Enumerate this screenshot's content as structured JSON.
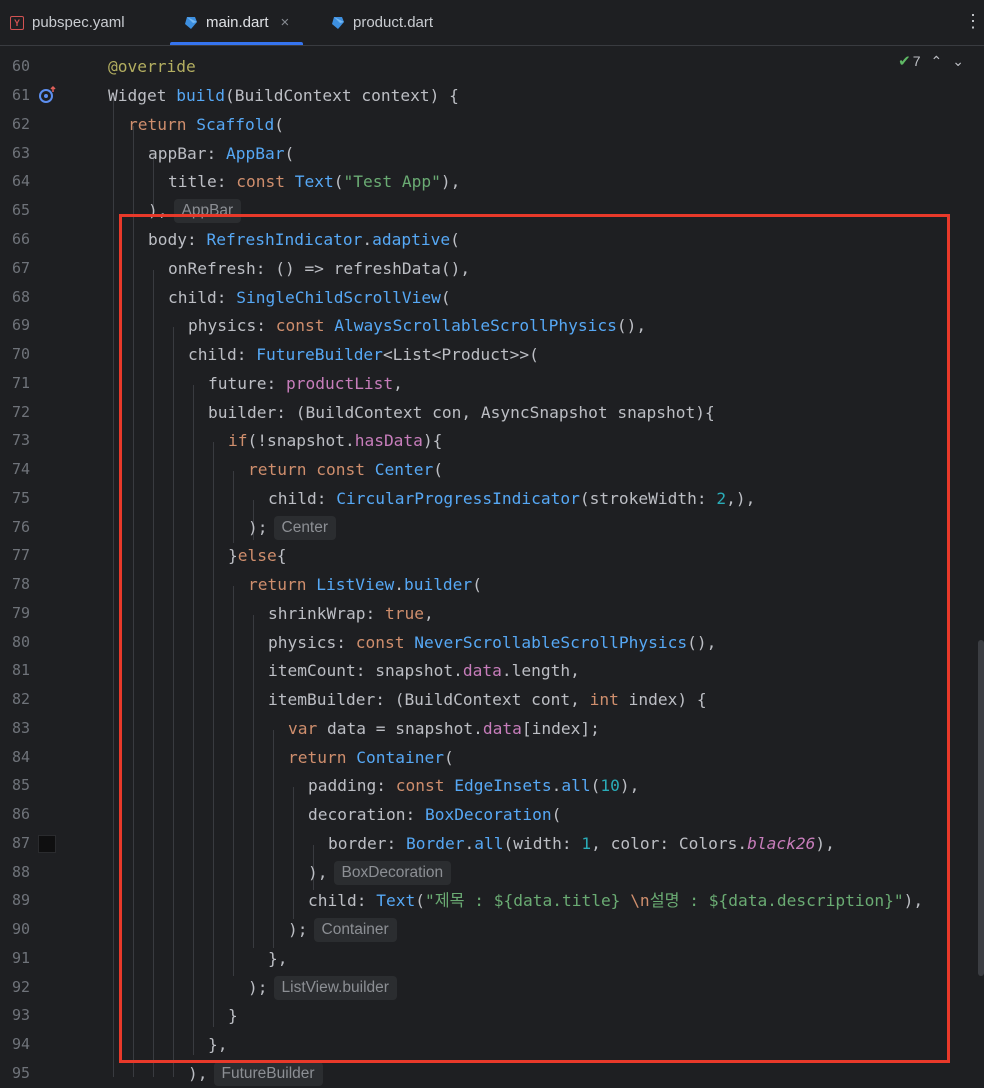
{
  "tabs": [
    {
      "label": "pubspec.yaml",
      "icon": "yaml-file-icon"
    },
    {
      "label": "main.dart",
      "icon": "dart-file-icon",
      "active": true,
      "close": "×"
    },
    {
      "label": "product.dart",
      "icon": "dart-file-icon"
    }
  ],
  "more_menu_icon": "⋮",
  "inspection": {
    "check_count": "7",
    "up": "⌃",
    "down": "⌄"
  },
  "line_numbers": [
    "60",
    "61",
    "62",
    "63",
    "64",
    "65",
    "66",
    "67",
    "68",
    "69",
    "70",
    "71",
    "72",
    "73",
    "74",
    "75",
    "76",
    "77",
    "78",
    "79",
    "80",
    "81",
    "82",
    "83",
    "84",
    "85",
    "86",
    "87",
    "88",
    "89",
    "90",
    "91",
    "92",
    "93",
    "94",
    "95"
  ],
  "hints": {
    "appbar": "AppBar",
    "center": "Center",
    "boxdecoration": "BoxDecoration",
    "container": "Container",
    "listview_builder": "ListView.builder",
    "futurebuilder": "FutureBuilder"
  },
  "code": {
    "l60": "@override",
    "l61a": "Widget ",
    "l61b": "build",
    "l61c": "(BuildContext context) {",
    "l62a": "return ",
    "l62b": "Scaffold",
    "l62c": "(",
    "l63a": "appBar: ",
    "l63b": "AppBar",
    "l63c": "(",
    "l64a": "title: ",
    "l64b": "const ",
    "l64c": "Text",
    "l64d": "(",
    "l64e": "\"Test App\"",
    "l64f": "),",
    "l65a": "),",
    "l66a": "body: ",
    "l66b": "RefreshIndicator",
    "l66c": ".",
    "l66d": "adaptive",
    "l66e": "(",
    "l67a": "onRefresh: () => refreshData(),",
    "l68a": "child: ",
    "l68b": "SingleChildScrollView",
    "l68c": "(",
    "l69a": "physics: ",
    "l69b": "const ",
    "l69c": "AlwaysScrollableScrollPhysics",
    "l69d": "(),",
    "l70a": "child: ",
    "l70b": "FutureBuilder",
    "l70c": "<List<Product>>(",
    "l71a": "future: ",
    "l71b": "productList",
    "l71c": ",",
    "l72a": "builder: (BuildContext con, AsyncSnapshot snapshot){",
    "l73a": "if",
    "l73b": "(!snapshot.",
    "l73c": "hasData",
    "l73d": "){",
    "l74a": "return ",
    "l74b": "const ",
    "l74c": "Center",
    "l74d": "(",
    "l75a": "child: ",
    "l75b": "CircularProgressIndicator",
    "l75c": "(strokeWidth: ",
    "l75d": "2",
    "l75e": ",),",
    "l76a": ");",
    "l77a": "}",
    "l77b": "else",
    "l77c": "{",
    "l78a": "return ",
    "l78b": "ListView",
    "l78c": ".",
    "l78d": "builder",
    "l78e": "(",
    "l79a": "shrinkWrap: ",
    "l79b": "true",
    "l79c": ",",
    "l80a": "physics: ",
    "l80b": "const ",
    "l80c": "NeverScrollableScrollPhysics",
    "l80d": "(),",
    "l81a": "itemCount: snapshot.",
    "l81b": "data",
    "l81c": ".length,",
    "l82a": "itemBuilder: (BuildContext cont, ",
    "l82b": "int ",
    "l82c": "index) {",
    "l83a": "var ",
    "l83b": "data = snapshot.",
    "l83c": "data",
    "l83d": "[index];",
    "l84a": "return ",
    "l84b": "Container",
    "l84c": "(",
    "l85a": "padding: ",
    "l85b": "const ",
    "l85c": "EdgeInsets",
    "l85d": ".",
    "l85e": "all",
    "l85f": "(",
    "l85g": "10",
    "l85h": "),",
    "l86a": "decoration: ",
    "l86b": "BoxDecoration",
    "l86c": "(",
    "l87a": "border: ",
    "l87b": "Border",
    "l87c": ".",
    "l87d": "all",
    "l87e": "(width: ",
    "l87f": "1",
    "l87g": ", color: Colors.",
    "l87h": "black26",
    "l87i": "),",
    "l88a": "),",
    "l89a": "child: ",
    "l89b": "Text",
    "l89c": "(",
    "l89d": "\"제목 : ${data.title} ",
    "l89e": "\\n",
    "l89f": "설명 : ${data.description}\"",
    "l89g": "),",
    "l90a": ");",
    "l91a": "},",
    "l92a": ");",
    "l93a": "}",
    "l94a": "},",
    "l95a": "),"
  },
  "colors": {
    "accent": "#3574f0",
    "highlight_box": "#e8392a",
    "background": "#1e1f22"
  }
}
